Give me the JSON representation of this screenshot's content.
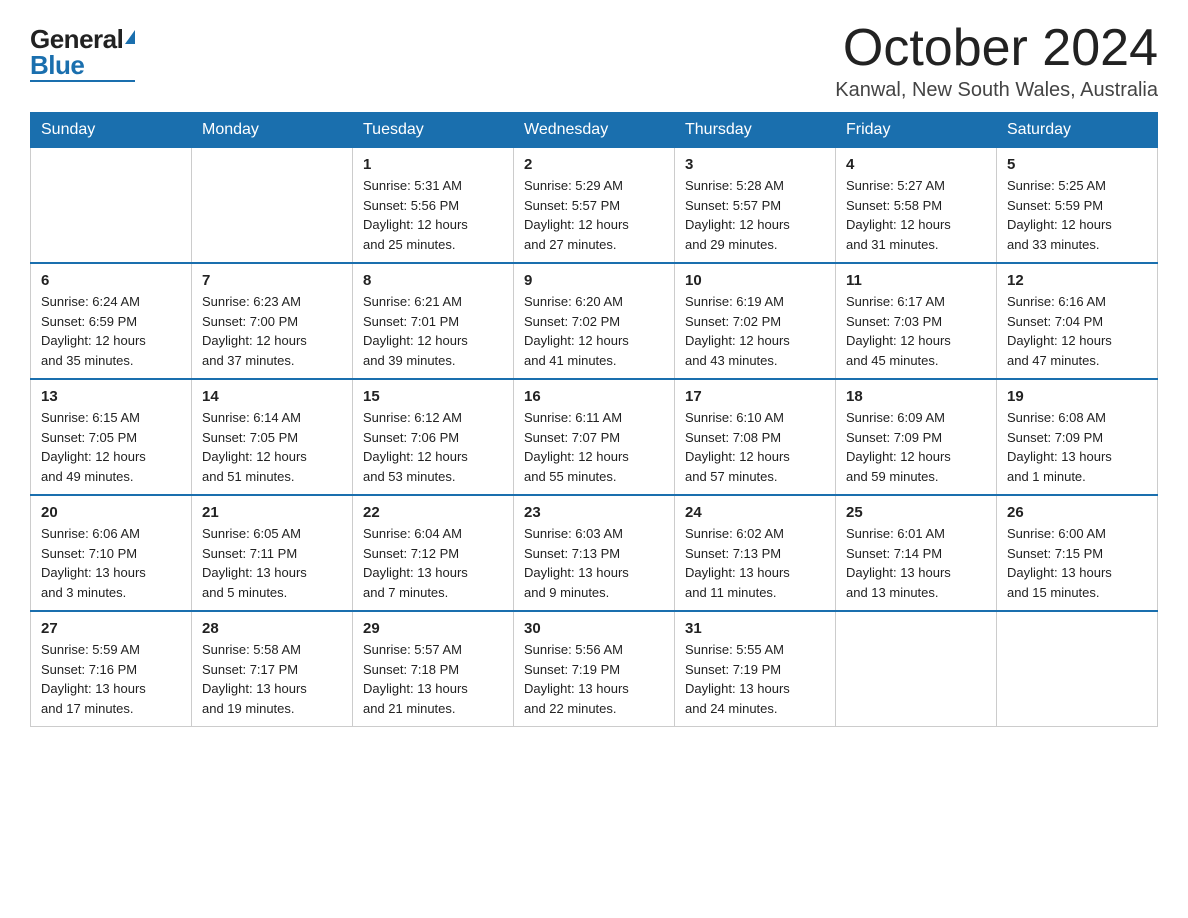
{
  "logo": {
    "general": "General",
    "blue": "Blue"
  },
  "title": "October 2024",
  "subtitle": "Kanwal, New South Wales, Australia",
  "days_of_week": [
    "Sunday",
    "Monday",
    "Tuesday",
    "Wednesday",
    "Thursday",
    "Friday",
    "Saturday"
  ],
  "weeks": [
    [
      {
        "day": "",
        "info": ""
      },
      {
        "day": "",
        "info": ""
      },
      {
        "day": "1",
        "info": "Sunrise: 5:31 AM\nSunset: 5:56 PM\nDaylight: 12 hours\nand 25 minutes."
      },
      {
        "day": "2",
        "info": "Sunrise: 5:29 AM\nSunset: 5:57 PM\nDaylight: 12 hours\nand 27 minutes."
      },
      {
        "day": "3",
        "info": "Sunrise: 5:28 AM\nSunset: 5:57 PM\nDaylight: 12 hours\nand 29 minutes."
      },
      {
        "day": "4",
        "info": "Sunrise: 5:27 AM\nSunset: 5:58 PM\nDaylight: 12 hours\nand 31 minutes."
      },
      {
        "day": "5",
        "info": "Sunrise: 5:25 AM\nSunset: 5:59 PM\nDaylight: 12 hours\nand 33 minutes."
      }
    ],
    [
      {
        "day": "6",
        "info": "Sunrise: 6:24 AM\nSunset: 6:59 PM\nDaylight: 12 hours\nand 35 minutes."
      },
      {
        "day": "7",
        "info": "Sunrise: 6:23 AM\nSunset: 7:00 PM\nDaylight: 12 hours\nand 37 minutes."
      },
      {
        "day": "8",
        "info": "Sunrise: 6:21 AM\nSunset: 7:01 PM\nDaylight: 12 hours\nand 39 minutes."
      },
      {
        "day": "9",
        "info": "Sunrise: 6:20 AM\nSunset: 7:02 PM\nDaylight: 12 hours\nand 41 minutes."
      },
      {
        "day": "10",
        "info": "Sunrise: 6:19 AM\nSunset: 7:02 PM\nDaylight: 12 hours\nand 43 minutes."
      },
      {
        "day": "11",
        "info": "Sunrise: 6:17 AM\nSunset: 7:03 PM\nDaylight: 12 hours\nand 45 minutes."
      },
      {
        "day": "12",
        "info": "Sunrise: 6:16 AM\nSunset: 7:04 PM\nDaylight: 12 hours\nand 47 minutes."
      }
    ],
    [
      {
        "day": "13",
        "info": "Sunrise: 6:15 AM\nSunset: 7:05 PM\nDaylight: 12 hours\nand 49 minutes."
      },
      {
        "day": "14",
        "info": "Sunrise: 6:14 AM\nSunset: 7:05 PM\nDaylight: 12 hours\nand 51 minutes."
      },
      {
        "day": "15",
        "info": "Sunrise: 6:12 AM\nSunset: 7:06 PM\nDaylight: 12 hours\nand 53 minutes."
      },
      {
        "day": "16",
        "info": "Sunrise: 6:11 AM\nSunset: 7:07 PM\nDaylight: 12 hours\nand 55 minutes."
      },
      {
        "day": "17",
        "info": "Sunrise: 6:10 AM\nSunset: 7:08 PM\nDaylight: 12 hours\nand 57 minutes."
      },
      {
        "day": "18",
        "info": "Sunrise: 6:09 AM\nSunset: 7:09 PM\nDaylight: 12 hours\nand 59 minutes."
      },
      {
        "day": "19",
        "info": "Sunrise: 6:08 AM\nSunset: 7:09 PM\nDaylight: 13 hours\nand 1 minute."
      }
    ],
    [
      {
        "day": "20",
        "info": "Sunrise: 6:06 AM\nSunset: 7:10 PM\nDaylight: 13 hours\nand 3 minutes."
      },
      {
        "day": "21",
        "info": "Sunrise: 6:05 AM\nSunset: 7:11 PM\nDaylight: 13 hours\nand 5 minutes."
      },
      {
        "day": "22",
        "info": "Sunrise: 6:04 AM\nSunset: 7:12 PM\nDaylight: 13 hours\nand 7 minutes."
      },
      {
        "day": "23",
        "info": "Sunrise: 6:03 AM\nSunset: 7:13 PM\nDaylight: 13 hours\nand 9 minutes."
      },
      {
        "day": "24",
        "info": "Sunrise: 6:02 AM\nSunset: 7:13 PM\nDaylight: 13 hours\nand 11 minutes."
      },
      {
        "day": "25",
        "info": "Sunrise: 6:01 AM\nSunset: 7:14 PM\nDaylight: 13 hours\nand 13 minutes."
      },
      {
        "day": "26",
        "info": "Sunrise: 6:00 AM\nSunset: 7:15 PM\nDaylight: 13 hours\nand 15 minutes."
      }
    ],
    [
      {
        "day": "27",
        "info": "Sunrise: 5:59 AM\nSunset: 7:16 PM\nDaylight: 13 hours\nand 17 minutes."
      },
      {
        "day": "28",
        "info": "Sunrise: 5:58 AM\nSunset: 7:17 PM\nDaylight: 13 hours\nand 19 minutes."
      },
      {
        "day": "29",
        "info": "Sunrise: 5:57 AM\nSunset: 7:18 PM\nDaylight: 13 hours\nand 21 minutes."
      },
      {
        "day": "30",
        "info": "Sunrise: 5:56 AM\nSunset: 7:19 PM\nDaylight: 13 hours\nand 22 minutes."
      },
      {
        "day": "31",
        "info": "Sunrise: 5:55 AM\nSunset: 7:19 PM\nDaylight: 13 hours\nand 24 minutes."
      },
      {
        "day": "",
        "info": ""
      },
      {
        "day": "",
        "info": ""
      }
    ]
  ]
}
